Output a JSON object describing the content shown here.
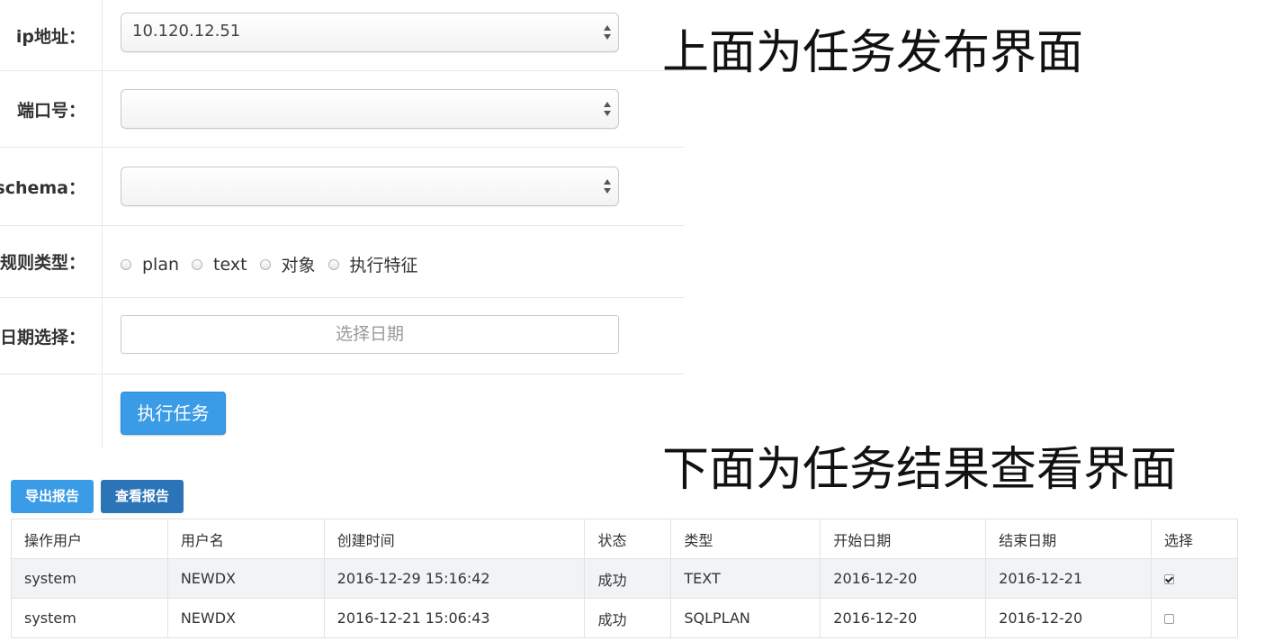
{
  "form": {
    "ip": {
      "label": "ip地址：",
      "value": "10.120.12.51"
    },
    "port": {
      "label": "端口号：",
      "value": ""
    },
    "schema": {
      "label": "schema：",
      "value": ""
    },
    "rule_type": {
      "label": "规则类型：",
      "options": [
        "plan",
        "text",
        "对象",
        "执行特征"
      ]
    },
    "date": {
      "label": "日期选择：",
      "placeholder": "选择日期"
    },
    "run_button": "执行任务"
  },
  "captions": {
    "top": "上面为任务发布界面",
    "bottom": "下面为任务结果查看界面"
  },
  "toolbar": {
    "export_label": "导出报告",
    "view_label": "查看报告"
  },
  "colors": {
    "primary": "#3a9be6",
    "primary_dark": "#2b74b8"
  },
  "table": {
    "columns": [
      "操作用户",
      "用户名",
      "创建时间",
      "状态",
      "类型",
      "开始日期",
      "结束日期",
      "选择"
    ],
    "rows": [
      {
        "operator": "system",
        "username": "NEWDX",
        "created": "2016-12-29 15:16:42",
        "status": "成功",
        "type": "TEXT",
        "start": "2016-12-20",
        "end": "2016-12-21",
        "selected": true
      },
      {
        "operator": "system",
        "username": "NEWDX",
        "created": "2016-12-21 15:06:43",
        "status": "成功",
        "type": "SQLPLAN",
        "start": "2016-12-20",
        "end": "2016-12-20",
        "selected": false
      }
    ]
  }
}
